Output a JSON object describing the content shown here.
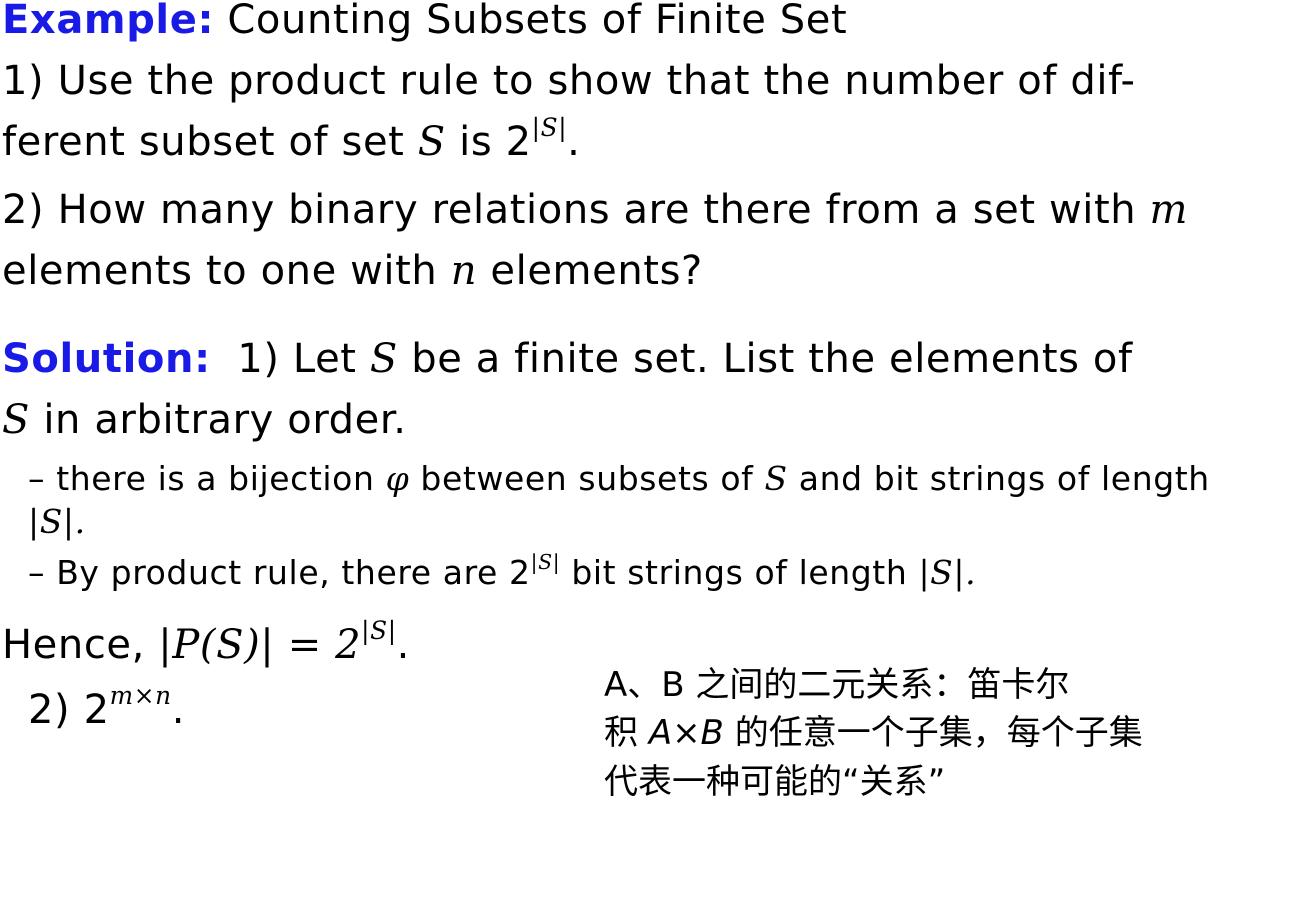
{
  "example": {
    "label": "Example:",
    "title": "Counting Subsets of Finite Set",
    "q1_line1": "1) Use the product rule to show that the number of dif-",
    "q1_line2_pre": "ferent subset of set",
    "q1_var": "S",
    "q1_is": "is 2",
    "q1_sup": "|S|",
    "q1_end": ".",
    "q2_line1_pre": "2) How many binary relations are there from a set with",
    "q2_var_m": "m",
    "q2_line2_pre": "elements to one with",
    "q2_var_n": "n",
    "q2_line2_post": "elements?"
  },
  "solution": {
    "label": "Solution:",
    "s1_pre": "1) Let",
    "s1_var": "S",
    "s1_post": "be a finite set.  List the elements of",
    "s2_var": "S",
    "s2_post": "in arbitrary order.",
    "bullet1_pre": "– there is a bijection",
    "bullet1_phi": "φ",
    "bullet1_mid": "between subsets of",
    "bullet1_var": "S",
    "bullet1_post": "and bit strings of length",
    "bullet1_cont": "|S|.",
    "bullet2_pre": "– By product rule, there are 2",
    "bullet2_sup": "|S|",
    "bullet2_mid": "bit strings of length",
    "bullet2_end": "|S|.",
    "hence_pre": "Hence,",
    "hence_expr": "|P(S)| = 2",
    "hence_sup": "|S|",
    "hence_end": ".",
    "part2_pre": "2) 2",
    "part2_sup": "m×n",
    "part2_end": "."
  },
  "annotation": {
    "line1": "A、B 之间的二元关系：笛卡尔",
    "line2_pre": "积",
    "line2_expr": "A×B",
    "line2_post": "的任意一个子集，每个子集",
    "line3": "代表一种可能的“关系”"
  },
  "colors": {
    "keyword": "#1a1ae6",
    "text": "#000000",
    "background": "#ffffff"
  }
}
